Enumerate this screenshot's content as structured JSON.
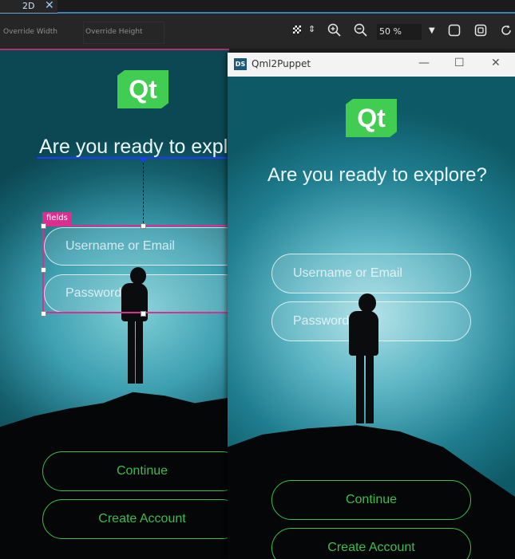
{
  "tab": {
    "label": "2D",
    "close": "✕"
  },
  "toolbar": {
    "override_width_placeholder": "Override Width",
    "override_height_placeholder": "Override Height",
    "zoom_value": "50 %"
  },
  "editor": {
    "logo_text": "Qt",
    "headline": "Are you ready to explore?",
    "selection_label": "fields",
    "username_placeholder": "Username or Email",
    "password_placeholder": "Password",
    "continue_label": "Continue",
    "create_account_label": "Create Account"
  },
  "preview_window": {
    "app_badge": "DS",
    "title": "Qml2Puppet",
    "minimize": "—",
    "maximize": "☐",
    "close": "✕",
    "logo_text": "Qt",
    "headline": "Are you ready to explore?",
    "username_placeholder": "Username or Email",
    "password_placeholder": "Password",
    "continue_label": "Continue",
    "create_account_label": "Create Account"
  },
  "colors": {
    "accent_green": "#41cd52",
    "selection_pink": "#d9308f",
    "anchor_blue": "#1a3cff"
  }
}
